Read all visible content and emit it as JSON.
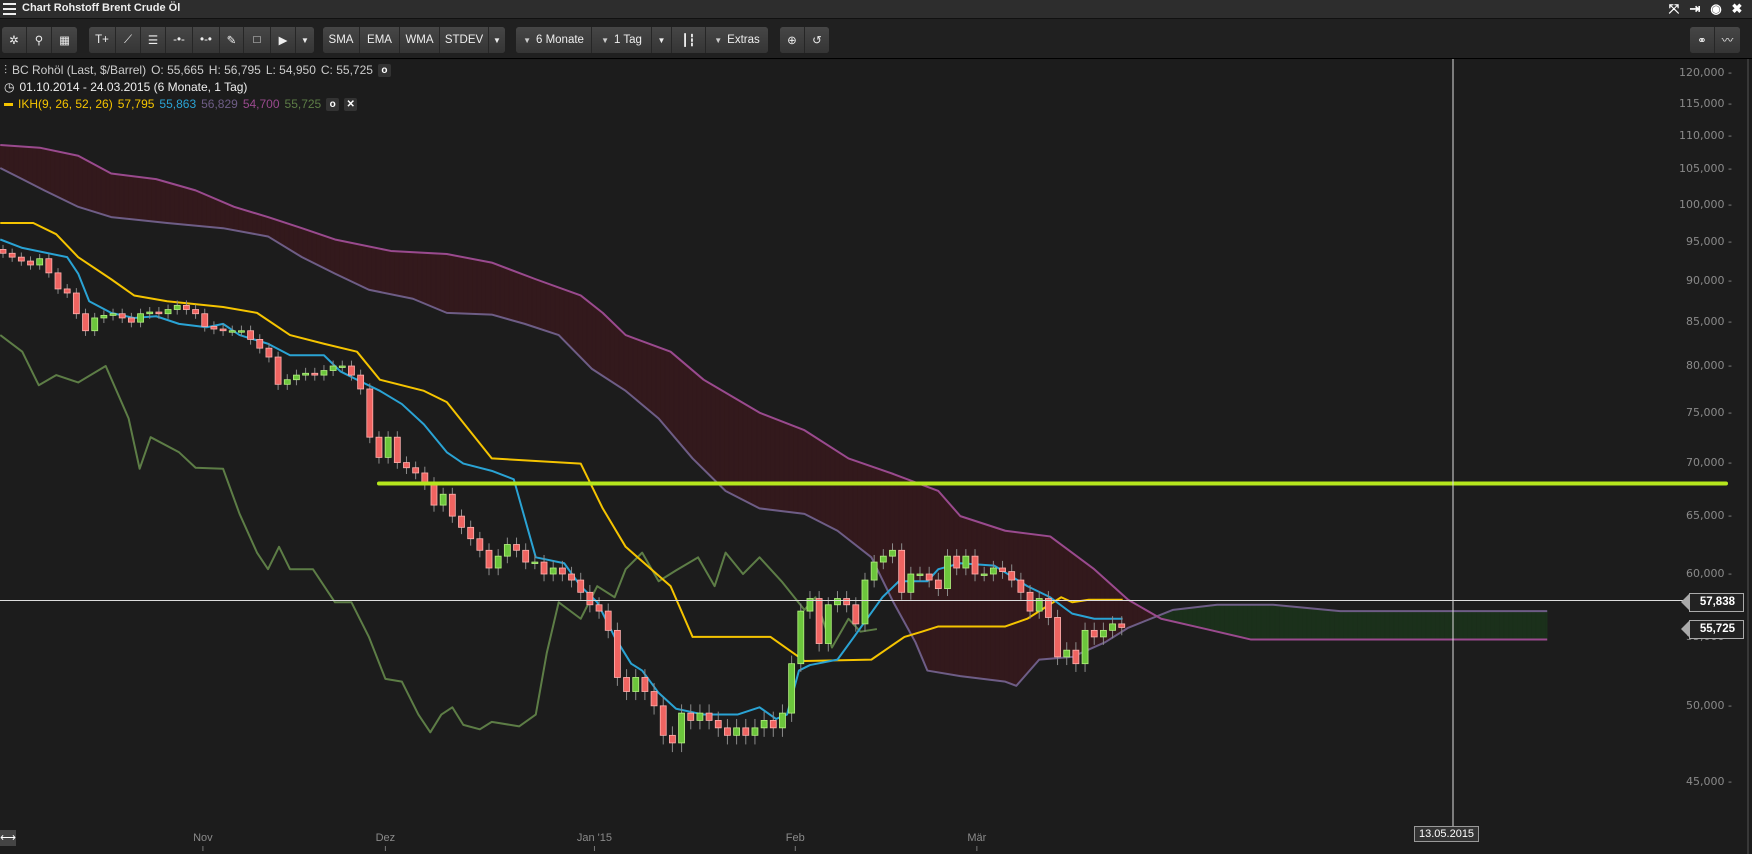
{
  "window": {
    "title": "Chart Rohstoff Brent Crude Öl",
    "icons": [
      "fullscreen-icon",
      "export-icon",
      "eye-icon",
      "close-icon"
    ]
  },
  "toolbar": {
    "tools": [
      "settings-icon",
      "search-icon",
      "grid-icon",
      "text-icon",
      "trendline-icon",
      "fibonacci-icon",
      "horizontal-line-icon",
      "horizontal-ray-icon",
      "pencil-icon",
      "rectangle-icon",
      "cursor-icon"
    ],
    "indicators": [
      "SMA",
      "EMA",
      "WMA",
      "STDEV"
    ],
    "period": "6 Monate",
    "interval": "1 Tag",
    "extras": "Extras",
    "right_icons": [
      "compare-icon",
      "chart-type-icon"
    ]
  },
  "legend": {
    "instrument": "BC Rohöl (Last, $/Barrel)",
    "open": "O: 55,665",
    "high": "H: 56,795",
    "low": "L: 54,950",
    "close": "C: 55,725",
    "range": "01.10.2014 - 24.03.2015 (6 Monate, 1 Tag)",
    "indicator": "IKH(9, 26, 52, 26)",
    "ind_values": [
      "57,795",
      "55,863",
      "56,829",
      "54,700",
      "55,725"
    ]
  },
  "colors": {
    "up": "#6cc63c",
    "down": "#ef6461",
    "tenkan": "#2aa3d4",
    "kijun": "#f5c400",
    "senkou_a": "#6e5d86",
    "senkou_b": "#9a4a8e",
    "chikou": "#5d7d46",
    "cloud_bear": "#33191c",
    "cloud_bull": "#1b301b",
    "hline": "#b5e61d"
  },
  "crosshair": {
    "price_label": "57,838",
    "last_label": "55,725",
    "date_label": "13.05.2015",
    "price": 57.838
  },
  "chart_data": {
    "type": "candlestick",
    "title": "BC Rohöl (Last, $/Barrel)",
    "ylim": [
      45,
      120
    ],
    "yscale": "log",
    "y_ticks": [
      45,
      50,
      55,
      60,
      65,
      70,
      75,
      80,
      85,
      90,
      95,
      100,
      105,
      110,
      115,
      120
    ],
    "y_tick_labels": [
      "45,000",
      "50,000",
      "55,000",
      "60,000",
      "65,000",
      "70,000",
      "75,000",
      "80,000",
      "85,000",
      "90,000",
      "95,000",
      "100,000",
      "105,000",
      "110,000",
      "115,000",
      "120,000"
    ],
    "x_ticks": [
      {
        "label": "Nov",
        "bar": 21.8
      },
      {
        "label": "Dez",
        "bar": 41.7
      },
      {
        "label": "Jan '15",
        "bar": 64.5
      },
      {
        "label": "Feb",
        "bar": 86.4
      },
      {
        "label": "Mär",
        "bar": 106.2
      }
    ],
    "close": [
      93.5,
      93.0,
      92.5,
      92.0,
      92.8,
      91.0,
      89.0,
      88.5,
      86.0,
      84.0,
      85.5,
      85.8,
      86.0,
      85.5,
      85.0,
      86.0,
      86.2,
      86.0,
      86.5,
      87.0,
      86.5,
      86.0,
      84.5,
      84.2,
      84.0,
      84.0,
      84.0,
      83.0,
      82.0,
      81.0,
      78.0,
      78.5,
      79.0,
      79.2,
      79.0,
      79.5,
      80.0,
      80.0,
      79.0,
      77.5,
      72.5,
      70.5,
      72.5,
      70.0,
      69.5,
      69.0,
      68.0,
      66.0,
      67.0,
      65.0,
      64.0,
      63.0,
      62.0,
      60.5,
      61.5,
      62.5,
      62.0,
      61.0,
      61.0,
      60.0,
      60.5,
      60.0,
      59.5,
      58.5,
      57.5,
      57.0,
      55.5,
      52.0,
      51.0,
      52.0,
      51.0,
      50.0,
      48.0,
      47.5,
      49.5,
      49.0,
      49.5,
      49.0,
      48.5,
      48.0,
      48.5,
      48.0,
      48.5,
      49.0,
      48.5,
      49.5,
      53.0,
      57.0,
      58.0,
      54.5,
      57.5,
      58.0,
      57.5,
      56.0,
      59.5,
      61.0,
      61.5,
      62.0,
      58.5,
      60.0,
      60.0,
      59.5,
      58.8,
      61.5,
      60.5,
      61.5,
      60.0,
      60.0,
      60.5,
      60.2,
      59.5,
      58.5,
      57.0,
      58.0,
      56.5,
      53.5,
      54.0,
      53.0,
      55.5,
      55.0,
      55.5,
      56.0,
      55.725
    ],
    "first_open": 94.0,
    "series": [
      {
        "name": "Senkou B",
        "key": "senkou_b",
        "points": [
          [
            -0.3,
            108.6
          ],
          [
            4,
            108.2
          ],
          [
            8.2,
            107
          ],
          [
            11.8,
            104.4
          ],
          [
            16.7,
            103.6
          ],
          [
            21,
            102
          ],
          [
            25.2,
            99.7
          ],
          [
            28.9,
            98.3
          ],
          [
            32.6,
            96.8
          ],
          [
            36.2,
            95.3
          ],
          [
            42.3,
            93.8
          ],
          [
            48.4,
            93.4
          ],
          [
            53.3,
            92.3
          ],
          [
            58.1,
            90.2
          ],
          [
            63,
            88.2
          ],
          [
            65.4,
            86.1
          ],
          [
            67.9,
            83.5
          ],
          [
            72.8,
            81.6
          ],
          [
            76.4,
            78.5
          ],
          [
            82.5,
            75
          ],
          [
            87.4,
            73.2
          ],
          [
            92.2,
            70.4
          ],
          [
            97.1,
            68.9
          ],
          [
            102,
            67.3
          ],
          [
            104.4,
            65
          ],
          [
            109.3,
            63.7
          ],
          [
            114.2,
            63.2
          ],
          [
            119,
            60.4
          ],
          [
            122.7,
            57.9
          ],
          [
            126.3,
            56.4
          ],
          [
            131.2,
            55.6
          ],
          [
            136.1,
            54.8
          ],
          [
            168.4,
            54.8
          ]
        ]
      },
      {
        "name": "Senkou A",
        "key": "senkou_a",
        "points": [
          [
            -0.3,
            105.2
          ],
          [
            2.1,
            103.6
          ],
          [
            4.5,
            102
          ],
          [
            8.2,
            99.7
          ],
          [
            11.8,
            98.3
          ],
          [
            17.9,
            97.5
          ],
          [
            24,
            96.8
          ],
          [
            28.9,
            95.7
          ],
          [
            32.6,
            93
          ],
          [
            36.2,
            90.9
          ],
          [
            39.9,
            88.9
          ],
          [
            44.7,
            87.8
          ],
          [
            48.4,
            86.1
          ],
          [
            53.3,
            85.9
          ],
          [
            56.9,
            84.8
          ],
          [
            60.6,
            83.5
          ],
          [
            64.2,
            79.7
          ],
          [
            67.9,
            77.3
          ],
          [
            71.5,
            74.4
          ],
          [
            75.2,
            70.4
          ],
          [
            78.8,
            67.3
          ],
          [
            82.5,
            65.7
          ],
          [
            87.4,
            65.2
          ],
          [
            91,
            63.7
          ],
          [
            94.7,
            61.4
          ],
          [
            97.1,
            57.7
          ],
          [
            99.5,
            54.6
          ],
          [
            100.8,
            52.5
          ],
          [
            104.4,
            52.1
          ],
          [
            109.3,
            51.7
          ],
          [
            110.5,
            51.4
          ],
          [
            113,
            53.3
          ],
          [
            116.6,
            53.5
          ],
          [
            120.2,
            54.6
          ],
          [
            122.7,
            55.7
          ],
          [
            127.6,
            57.1
          ],
          [
            132.4,
            57.5
          ],
          [
            138.5,
            57.5
          ],
          [
            145.8,
            57
          ],
          [
            168.4,
            57
          ]
        ]
      },
      {
        "name": "Tenkan",
        "key": "tenkan",
        "points": [
          [
            -0.3,
            95.3
          ],
          [
            2.1,
            94.2
          ],
          [
            7,
            93
          ],
          [
            8.2,
            90.9
          ],
          [
            9.4,
            87.5
          ],
          [
            11.8,
            86.1
          ],
          [
            14.3,
            85.5
          ],
          [
            16.7,
            85.7
          ],
          [
            19.2,
            84.8
          ],
          [
            22.2,
            84.4
          ],
          [
            24,
            84.8
          ],
          [
            25.8,
            83.5
          ],
          [
            28.9,
            82.5
          ],
          [
            31.3,
            81.2
          ],
          [
            35,
            81.2
          ],
          [
            36.8,
            79.4
          ],
          [
            38.6,
            78.5
          ],
          [
            41.1,
            77.3
          ],
          [
            43.5,
            75.9
          ],
          [
            45.9,
            73.8
          ],
          [
            48.4,
            71
          ],
          [
            50.2,
            69.9
          ],
          [
            53.3,
            69.2
          ],
          [
            55.7,
            68.4
          ],
          [
            58.1,
            61.4
          ],
          [
            61.2,
            60.9
          ],
          [
            63,
            59
          ],
          [
            64.8,
            57.7
          ],
          [
            66.7,
            55
          ],
          [
            68.5,
            53
          ],
          [
            69.7,
            52.5
          ],
          [
            71.5,
            50.9
          ],
          [
            73.4,
            49.8
          ],
          [
            76.4,
            49.4
          ],
          [
            80.1,
            49.4
          ],
          [
            82.5,
            49.9
          ],
          [
            84.3,
            49.1
          ],
          [
            85.5,
            49.4
          ],
          [
            86.8,
            52.5
          ],
          [
            88,
            52.9
          ],
          [
            91,
            53.3
          ],
          [
            92.8,
            55
          ],
          [
            95.9,
            58.1
          ],
          [
            97.7,
            59.4
          ],
          [
            100.8,
            59.4
          ],
          [
            102,
            60.4
          ],
          [
            104.4,
            60.9
          ],
          [
            108.1,
            60.7
          ],
          [
            111.7,
            59
          ],
          [
            114.2,
            58.1
          ],
          [
            116.6,
            56.8
          ],
          [
            119,
            56.4
          ],
          [
            122.1,
            56.4
          ]
        ]
      },
      {
        "name": "Kijun",
        "key": "kijun",
        "points": [
          [
            -0.3,
            97.5
          ],
          [
            3.3,
            97.5
          ],
          [
            5.8,
            96
          ],
          [
            8.2,
            93
          ],
          [
            11.8,
            90.2
          ],
          [
            14.3,
            88.2
          ],
          [
            17.9,
            87.5
          ],
          [
            24,
            86.8
          ],
          [
            27.7,
            86.1
          ],
          [
            31.3,
            83.5
          ],
          [
            35,
            82.5
          ],
          [
            38.6,
            81.6
          ],
          [
            41.1,
            78.5
          ],
          [
            45.9,
            77.3
          ],
          [
            48.4,
            76.1
          ],
          [
            53.3,
            70.4
          ],
          [
            63,
            69.9
          ],
          [
            65.4,
            65.7
          ],
          [
            67.9,
            62.3
          ],
          [
            72.8,
            59
          ],
          [
            75.2,
            55
          ],
          [
            83.7,
            55
          ],
          [
            87.4,
            53.2
          ],
          [
            94.7,
            53.3
          ],
          [
            98.3,
            55
          ],
          [
            100.2,
            55.4
          ],
          [
            102,
            55.8
          ],
          [
            109.3,
            55.8
          ],
          [
            111.7,
            56.4
          ],
          [
            115.4,
            58.1
          ],
          [
            116.6,
            57.7
          ],
          [
            118.4,
            57.9
          ],
          [
            122.1,
            57.9
          ]
        ]
      },
      {
        "name": "Chikou",
        "key": "chikou",
        "points": [
          [
            -0.3,
            83.5
          ],
          [
            2.1,
            81.6
          ],
          [
            3.9,
            77.9
          ],
          [
            5.8,
            79
          ],
          [
            8.2,
            78.2
          ],
          [
            11.2,
            80
          ],
          [
            13.7,
            74.4
          ],
          [
            14.9,
            69.4
          ],
          [
            16.1,
            72.5
          ],
          [
            19.2,
            71
          ],
          [
            21,
            69.5
          ],
          [
            24,
            69.4
          ],
          [
            25.8,
            65.2
          ],
          [
            27.7,
            61.8
          ],
          [
            28.9,
            60.4
          ],
          [
            30.1,
            62.3
          ],
          [
            31.3,
            60.4
          ],
          [
            33.8,
            60.4
          ],
          [
            36.2,
            57.7
          ],
          [
            38,
            57.7
          ],
          [
            39.9,
            55
          ],
          [
            41.7,
            51.9
          ],
          [
            43.5,
            51.7
          ],
          [
            45.3,
            49.4
          ],
          [
            46.6,
            48.2
          ],
          [
            47.8,
            49.4
          ],
          [
            49,
            49.9
          ],
          [
            50.2,
            48.7
          ],
          [
            52,
            48.4
          ],
          [
            53.3,
            48.9
          ],
          [
            56.3,
            48.6
          ],
          [
            58.1,
            49.4
          ],
          [
            59.3,
            53.8
          ],
          [
            60.6,
            57.7
          ],
          [
            63,
            56.4
          ],
          [
            64.8,
            59
          ],
          [
            66.7,
            58.1
          ],
          [
            67.9,
            60.4
          ],
          [
            69.7,
            61.8
          ],
          [
            71.5,
            59.4
          ],
          [
            73.4,
            60.3
          ],
          [
            75.8,
            61.4
          ],
          [
            77.6,
            59
          ],
          [
            78.8,
            61.8
          ],
          [
            80.7,
            60
          ],
          [
            82.5,
            61.4
          ],
          [
            84.9,
            59.4
          ],
          [
            87.4,
            57.1
          ],
          [
            88.6,
            58.1
          ],
          [
            90.4,
            54.2
          ],
          [
            92.2,
            56.4
          ],
          [
            93.5,
            55.4
          ],
          [
            95.3,
            55.6
          ]
        ]
      }
    ],
    "horizontal_line": {
      "price": 68.0,
      "start_bar": 41
    }
  }
}
